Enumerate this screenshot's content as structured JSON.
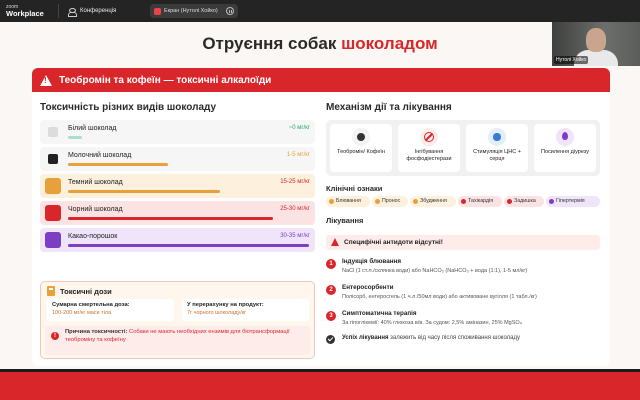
{
  "zoom": {
    "logo_top": "zoom",
    "logo_bottom": "Workplace",
    "conference_label": "Конференція",
    "share_label": "Екран (Нутолі Хойко)",
    "video_name": "Нутолі Хойко"
  },
  "slide": {
    "title_main": "Отруєння собак",
    "title_accent": "шоколадом",
    "banner": "Теобромін та кофеїн — токсичні алкалоїди",
    "left": {
      "heading": "Токсичність різних видів шоколаду",
      "rows": [
        {
          "name": "Білий шоколад",
          "dose": "~0 мг/кг",
          "color": "#dcdcdc",
          "bar": "#a8e0d0",
          "dose_color": "#2aa86a",
          "fill": 0.08
        },
        {
          "name": "Молочний шоколад",
          "dose": "1-5 мг/кг",
          "color": "#222222",
          "bar": "#e8a03a",
          "dose_color": "#e8a03a",
          "fill": 0.65
        },
        {
          "name": "Темний шоколад",
          "dose": "15-25 мг/кг",
          "color": "#e8a03a",
          "bar": "#e8a03a",
          "dose_color": "#d8262a",
          "fill": 0.72
        },
        {
          "name": "Чорний шоколад",
          "dose": "25-30 мг/кг",
          "color": "#d8262a",
          "bar": "#d8262a",
          "dose_color": "#d8262a",
          "fill": 0.85
        },
        {
          "name": "Какао-порошок",
          "dose": "30-35 мг/кг",
          "color": "#7b3fc4",
          "bar": "#7b3fc4",
          "dose_color": "#7b3fc4",
          "fill": 1.0
        }
      ],
      "tox": {
        "heading": "Токсичні дози",
        "box1_label": "Сумарна смертельна доза:",
        "box1_value": "100-200 мг/кг маси тіла",
        "box2_label": "У перерахунку на продукт:",
        "box2_value": "7г чорного шоколаду/кг",
        "cause_label": "Причина токсичності:",
        "cause_text": "Собаки не мають необхідних ензимів для біотрансформації теоброміну та кофеїну"
      }
    },
    "right": {
      "heading": "Механізм дії та лікування",
      "mech": [
        {
          "label": "Теобромін/ Кофеїн",
          "icon": "cookie-icon"
        },
        {
          "label": "Інгібування фосфодіестерази",
          "icon": "ban-icon"
        },
        {
          "label": "Стимуляція ЦНС + серця",
          "icon": "brain-icon"
        },
        {
          "label": "Посилення діурезу",
          "icon": "drop-icon"
        }
      ],
      "clinical_heading": "Клінічні ознаки",
      "tags": [
        {
          "label": "Блювання",
          "color": "#e8a03a"
        },
        {
          "label": "Пронос",
          "color": "#e8a03a"
        },
        {
          "label": "Збудження",
          "color": "#e8a03a"
        },
        {
          "label": "Тахікардія",
          "color": "#d8262a"
        },
        {
          "label": "Задишка",
          "color": "#d8262a"
        },
        {
          "label": "Гіпертермія",
          "color": "#7b3fc4"
        }
      ],
      "treatment_heading": "Лікування",
      "no_antidote": "Специфічні антидоти відсутні!",
      "steps": [
        {
          "num": "1",
          "title": "Індукція блювання",
          "desc": "NaCl (1 ст.л./склянка води) або NaHCO₃ (NaHCO₃ + вода (1:1), 1-5 мл/кг)"
        },
        {
          "num": "2",
          "title": "Ентеросорбенти",
          "desc": "Полісорб, ентеросгель (1 ч.л./50мл води) або активоване вугілля (1 табл./кг)"
        },
        {
          "num": "3",
          "title": "Симптоматична терапія",
          "desc": "За гіпоглікемії: 40% глюкоза в/в. За судом: 2,5% аміназин, 25% MgSO₄"
        }
      ],
      "success_label": "Успіх лікування",
      "success_text": "залежить від часу після споживання шоколаду"
    }
  }
}
